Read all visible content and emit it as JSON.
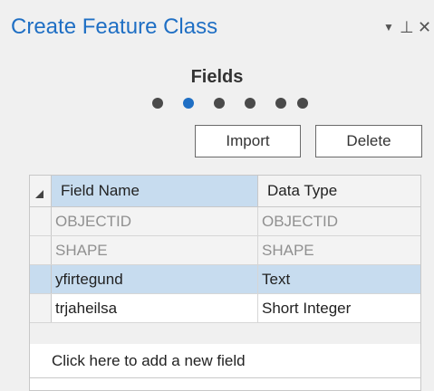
{
  "pane": {
    "title": "Create Feature Class",
    "controls": {
      "dropdown_icon": "chevron-down-icon",
      "pin_icon": "pin-icon",
      "close_icon": "close-icon"
    }
  },
  "wizard": {
    "step_title": "Fields",
    "step_count": 6,
    "active_step": 2
  },
  "buttons": {
    "import_label": "Import",
    "delete_label": "Delete"
  },
  "grid": {
    "columns": [
      "Field Name",
      "Data Type"
    ],
    "rows": [
      {
        "name": "OBJECTID",
        "type": "OBJECTID",
        "state": "readonly"
      },
      {
        "name": "SHAPE",
        "type": "SHAPE",
        "state": "readonly"
      },
      {
        "name": "yfirtegund",
        "type": "Text",
        "state": "selected"
      },
      {
        "name": "trjaheilsa",
        "type": "Short Integer",
        "state": "normal"
      }
    ],
    "add_new_text": "Click here to add a new field"
  },
  "colors": {
    "accent": "#1f6fc4",
    "selection": "#c7dcef",
    "readonly_text": "#909090"
  }
}
